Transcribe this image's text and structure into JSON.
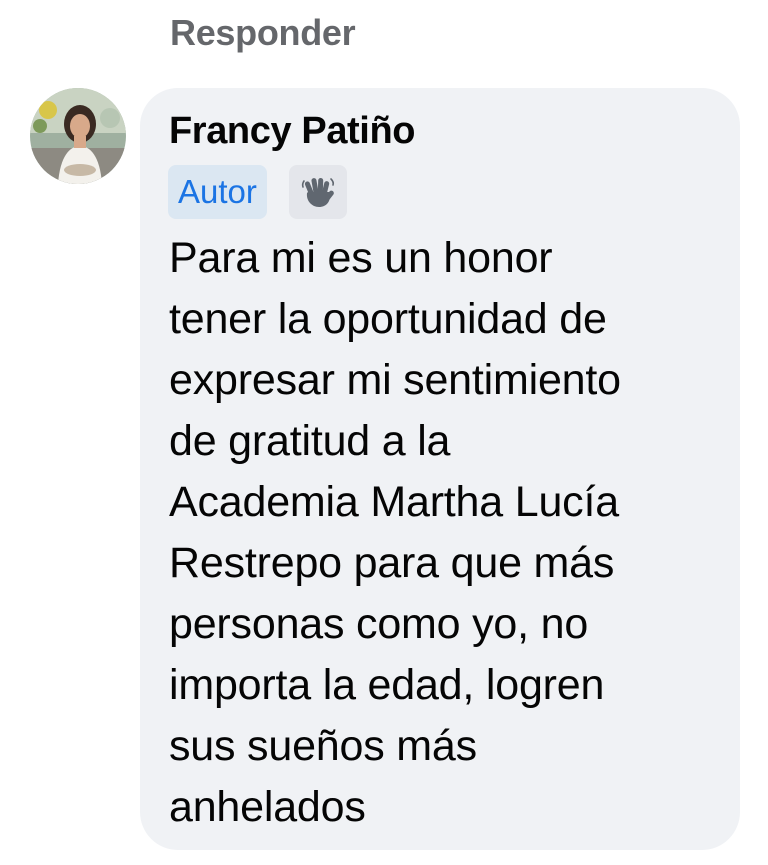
{
  "reply_label": "Responder",
  "comment": {
    "author": "Francy Patiño",
    "badge_label": "Autor",
    "badge_icon": "waving-hand-icon",
    "text": "Para mi es un honor\ntener la oportunidad de\nexpresar mi sentimiento\nde gratitud a la\nAcademia  Martha Lucía\nRestrepo para que más\npersonas como yo, no\nimporta la edad, logren\nsus sueños más\nanhelados"
  },
  "colors": {
    "bubble_background": "#f0f2f5",
    "reply_link": "#65676b",
    "badge_background": "#dbe7f2",
    "badge_text": "#1b74e4",
    "text": "#050505"
  }
}
